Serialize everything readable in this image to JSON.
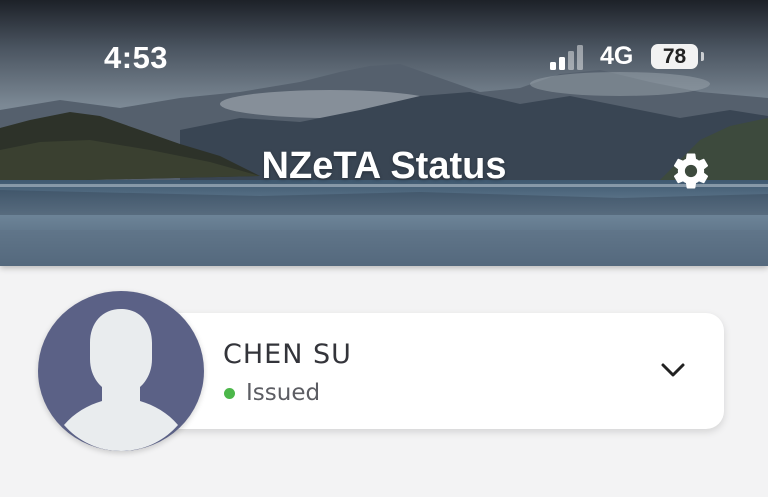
{
  "status_bar": {
    "time": "4:53",
    "network": "4G",
    "battery": "78"
  },
  "header": {
    "title": "NZeTA Status"
  },
  "applicant": {
    "name": "CHEN SU",
    "status": "Issued",
    "status_color": "#4cb74a"
  },
  "colors": {
    "avatar_bg": "#5b6186",
    "page_bg": "#f3f3f4"
  }
}
